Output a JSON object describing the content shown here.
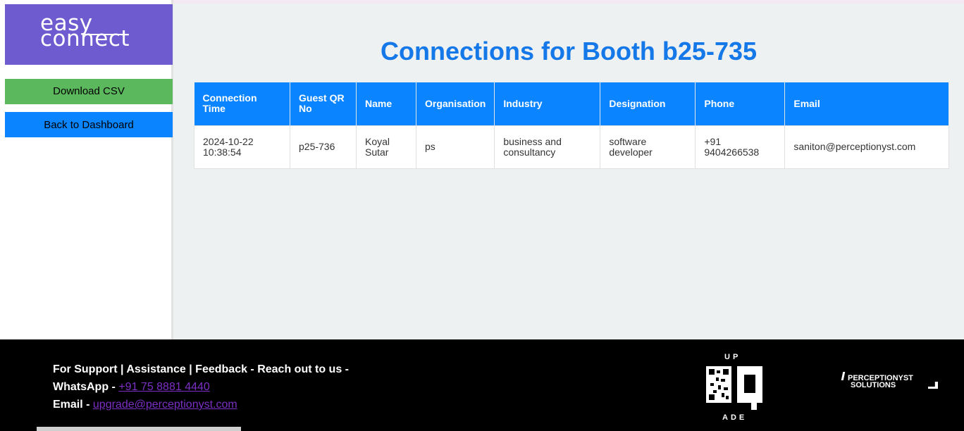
{
  "logo": {
    "line1": "easy",
    "line2": "connect"
  },
  "sidebar": {
    "download_csv": "Download CSV",
    "back_to_dashboard": "Back to Dashboard"
  },
  "page": {
    "title": "Connections for Booth b25-735"
  },
  "table": {
    "headers": [
      "Connection Time",
      "Guest QR No",
      "Name",
      "Organisation",
      "Industry",
      "Designation",
      "Phone",
      "Email"
    ],
    "rows": [
      [
        "2024-10-22 10:38:54",
        "p25-736",
        "Koyal Sutar",
        "ps",
        "business and consultancy",
        "software developer",
        "+91 9404266538",
        "saniton@perceptionyst.com"
      ]
    ]
  },
  "footer": {
    "support_line": "For Support | Assistance | Feedback - Reach out to us -",
    "whatsapp_label": "WhatsApp - ",
    "whatsapp_number": "+91 75 8881 4440",
    "email_label": "Email - ",
    "email_address": "upgrade@perceptionyst.com",
    "upqr_logo": {
      "top": "UP",
      "bottom": "ADE"
    },
    "perceptionyst_logo": {
      "line1": "PERCEPTIONYST",
      "line2": "SOLUTIONS"
    }
  },
  "colors": {
    "brand_purple": "#6f5bd0",
    "accent_blue": "#0a84ff",
    "title_blue": "#1578e8",
    "download_green": "#5cb85c",
    "footer_bg": "#000000",
    "link_purple": "#7b2fc4"
  }
}
